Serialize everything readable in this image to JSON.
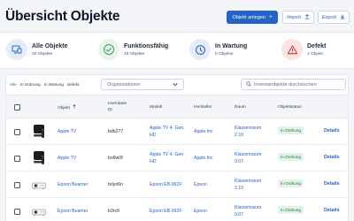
{
  "page": {
    "title": "Übersicht Objekte"
  },
  "toolbar": {
    "primary_label": "Objekt anlegen",
    "primary_icon": "plus-icon",
    "import_label": "Import",
    "import_icon": "upload-icon",
    "export_label": "Export",
    "export_icon": "download-icon"
  },
  "stats": [
    {
      "label": "Alle Objekte",
      "sub": "20 Objekte",
      "icon": "devices-icon",
      "color": "#2563c7"
    },
    {
      "label": "Funktionsfähig",
      "sub": "19 Objekte",
      "icon": "check-circle-icon",
      "color": "#3aa35a"
    },
    {
      "label": "In Wartung",
      "sub": "0 Objekte",
      "icon": "clock-icon",
      "color": "#2563c7"
    },
    {
      "label": "Defekt",
      "sub": "1 Objekt",
      "icon": "alert-icon",
      "color": "#c0392b"
    }
  ],
  "filters": {
    "tabs": [
      "Alle",
      "In Ordnung",
      "In Wartung",
      "Defekt"
    ],
    "active_tab": "Alle",
    "organisation_placeholder": "Organisationen",
    "search_placeholder": "Inventarobjekte durchsuchen"
  },
  "table": {
    "headers": {
      "object": "Objekt",
      "sort_icon": "arrow-up-icon",
      "inventory_1": "Inventarie",
      "inventory_2": "ID",
      "model": "Modell",
      "manufacturer": "Hersteller",
      "room": "Raum",
      "status": "Objektstatus"
    },
    "rows": [
      {
        "object": "Apple TV",
        "inventory_id": "bdb277",
        "model_1": "Apple TV 4. Gen.",
        "model_2": "HD",
        "manufacturer": "Apple Inc",
        "room_1": "Klassenraum",
        "room_2": "2.10",
        "status": "In Ordnung",
        "action": "Details",
        "thumb": "apple-tv-icon"
      },
      {
        "object": "Apple TV",
        "inventory_id": "bo8w0f",
        "model_1": "Apple TV 4. Gen.",
        "model_2": "HD",
        "manufacturer": "Apple Inc",
        "room_1": "Klassenraum",
        "room_2": "0.07",
        "status": "In Ordnung",
        "action": "Details",
        "thumb": "apple-tv-icon"
      },
      {
        "object": "Epson Beamer",
        "inventory_id": "brlyo6n",
        "model_1": "Epson EB-992F",
        "model_2": "",
        "manufacturer": "Epson",
        "room_1": "Klassenraum",
        "room_2": "2.10",
        "status": "In Ordnung",
        "action": "Details",
        "thumb": "projector-icon"
      },
      {
        "object": "Epson Beamer",
        "inventory_id": "b3rcft",
        "model_1": "Epson EB-992F",
        "model_2": "",
        "manufacturer": "Epson",
        "room_1": "Klassenraum",
        "room_2": "0.07",
        "status": "In Ordnung",
        "action": "Details",
        "thumb": "projector-icon"
      }
    ]
  }
}
